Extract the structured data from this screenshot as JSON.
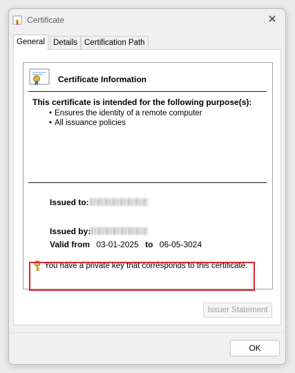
{
  "window": {
    "title": "Certificate",
    "close_glyph": "✕"
  },
  "tabs": [
    {
      "label": "General",
      "active": true
    },
    {
      "label": "Details",
      "active": false
    },
    {
      "label": "Certification Path",
      "active": false
    }
  ],
  "info": {
    "heading": "Certificate Information",
    "purpose_title": "This certificate is intended for the following purpose(s):",
    "purposes": [
      "Ensures the identity of a remote computer",
      "All issuance policies"
    ],
    "issued_to_label": "Issued to:",
    "issued_by_label": "Issued by:",
    "valid_from_label": "Valid from",
    "valid_from": "03-01-2025",
    "to_label": "to",
    "valid_to": "06-05-3024",
    "private_key_note": "You have a private key that corresponds to this certificate."
  },
  "buttons": {
    "issuer_statement": "Issuer Statement",
    "ok": "OK"
  },
  "colors": {
    "highlight": "#d7262b",
    "key_gold": "#d6a01d"
  }
}
